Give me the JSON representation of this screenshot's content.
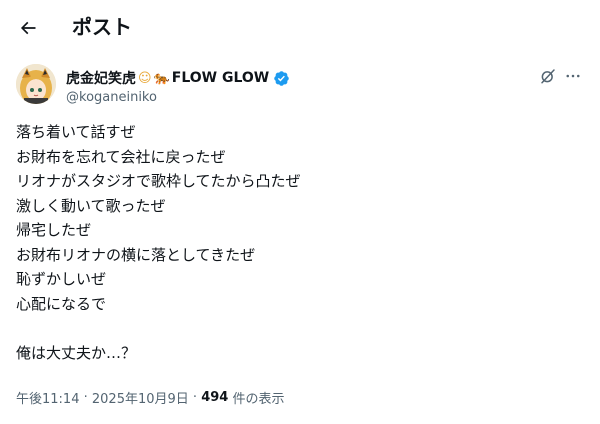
{
  "header": {
    "back_label": "←",
    "title": "ポスト"
  },
  "author": {
    "display_name": "虎金妃笑虎",
    "emoji_1": "☺",
    "emoji_2": "🐅",
    "suffix": "FLOW GLOW",
    "handle": "@koganeiniko",
    "verified_color": "#1d9bf0"
  },
  "tweet": {
    "lines": [
      "落ち着いて話すぜ",
      "お財布を忘れて会社に戻ったぜ",
      "リオナがスタジオで歌枠してたから凸たぜ",
      "激しく動いて歌ったぜ",
      "帰宅したぜ",
      "お財布リオナの横に落としてきたぜ",
      "恥ずかしいぜ",
      "心配になるで",
      "",
      "俺は大丈夫か…？"
    ]
  },
  "meta": {
    "time": "午後11:14",
    "separator_1": " · ",
    "date": "2025年10月9日",
    "separator_2": " · ",
    "views_count": "494",
    "views_label": " 件の表示"
  },
  "icons": {
    "back": "back-arrow-icon",
    "grok": "grok-icon",
    "more": "more-options-icon",
    "verified": "verified-badge-icon"
  }
}
